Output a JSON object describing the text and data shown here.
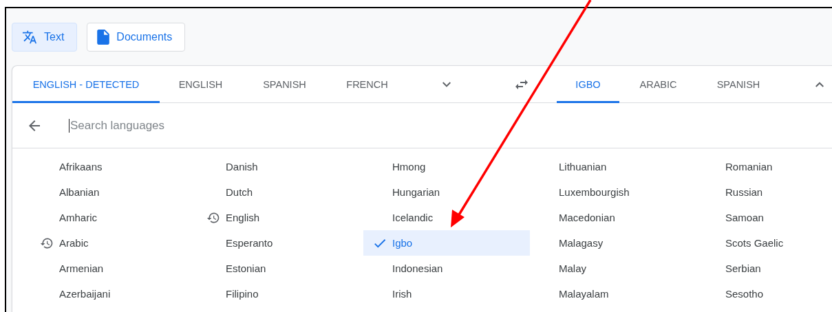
{
  "mode_buttons": [
    {
      "label": "Text",
      "selected": true
    },
    {
      "label": "Documents",
      "selected": false
    }
  ],
  "source_tabs": [
    {
      "label": "ENGLISH - DETECTED",
      "selected": true
    },
    {
      "label": "ENGLISH",
      "selected": false
    },
    {
      "label": "SPANISH",
      "selected": false
    },
    {
      "label": "FRENCH",
      "selected": false
    }
  ],
  "target_tabs": [
    {
      "label": "IGBO",
      "selected": true
    },
    {
      "label": "ARABIC",
      "selected": false
    },
    {
      "label": "SPANISH",
      "selected": false
    }
  ],
  "search": {
    "placeholder": "Search languages"
  },
  "languages": [
    {
      "label": "Afrikaans",
      "recent": false,
      "selected": false
    },
    {
      "label": "Albanian",
      "recent": false,
      "selected": false
    },
    {
      "label": "Amharic",
      "recent": false,
      "selected": false
    },
    {
      "label": "Arabic",
      "recent": true,
      "selected": false
    },
    {
      "label": "Armenian",
      "recent": false,
      "selected": false
    },
    {
      "label": "Azerbaijani",
      "recent": false,
      "selected": false
    },
    {
      "label": "Danish",
      "recent": false,
      "selected": false
    },
    {
      "label": "Dutch",
      "recent": false,
      "selected": false
    },
    {
      "label": "English",
      "recent": true,
      "selected": false
    },
    {
      "label": "Esperanto",
      "recent": false,
      "selected": false
    },
    {
      "label": "Estonian",
      "recent": false,
      "selected": false
    },
    {
      "label": "Filipino",
      "recent": false,
      "selected": false
    },
    {
      "label": "Hmong",
      "recent": false,
      "selected": false
    },
    {
      "label": "Hungarian",
      "recent": false,
      "selected": false
    },
    {
      "label": "Icelandic",
      "recent": false,
      "selected": false
    },
    {
      "label": "Igbo",
      "recent": false,
      "selected": true
    },
    {
      "label": "Indonesian",
      "recent": false,
      "selected": false
    },
    {
      "label": "Irish",
      "recent": false,
      "selected": false
    },
    {
      "label": "Lithuanian",
      "recent": false,
      "selected": false
    },
    {
      "label": "Luxembourgish",
      "recent": false,
      "selected": false
    },
    {
      "label": "Macedonian",
      "recent": false,
      "selected": false
    },
    {
      "label": "Malagasy",
      "recent": false,
      "selected": false
    },
    {
      "label": "Malay",
      "recent": false,
      "selected": false
    },
    {
      "label": "Malayalam",
      "recent": false,
      "selected": false
    },
    {
      "label": "Romanian",
      "recent": false,
      "selected": false
    },
    {
      "label": "Russian",
      "recent": false,
      "selected": false
    },
    {
      "label": "Samoan",
      "recent": false,
      "selected": false
    },
    {
      "label": "Scots Gaelic",
      "recent": false,
      "selected": false
    },
    {
      "label": "Serbian",
      "recent": false,
      "selected": false
    },
    {
      "label": "Sesotho",
      "recent": false,
      "selected": false
    }
  ]
}
